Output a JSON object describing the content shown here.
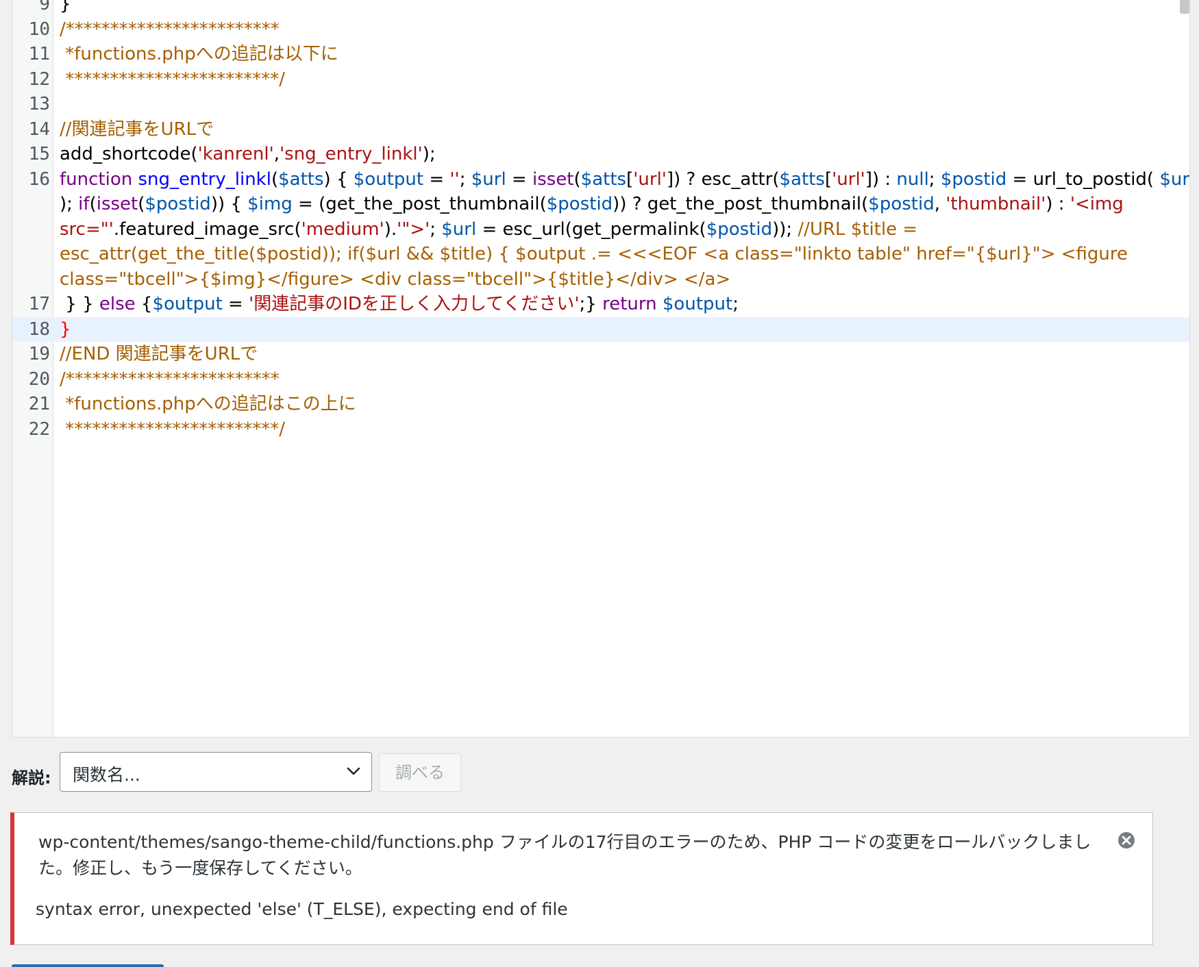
{
  "editor": {
    "lines": [
      {
        "num": "9",
        "segments": [
          {
            "t": "}",
            "c": "c-plain"
          }
        ]
      },
      {
        "num": "10",
        "segments": [
          {
            "t": "/************************",
            "c": "c-com"
          }
        ]
      },
      {
        "num": "11",
        "segments": [
          {
            "t": " *functions.phpへの追記は以下に",
            "c": "c-com"
          }
        ]
      },
      {
        "num": "12",
        "segments": [
          {
            "t": " ************************/",
            "c": "c-com"
          }
        ]
      },
      {
        "num": "13",
        "segments": []
      },
      {
        "num": "14",
        "segments": [
          {
            "t": "//関連記事をURLで",
            "c": "c-com"
          }
        ]
      },
      {
        "num": "15",
        "segments": [
          {
            "t": "add_shortcode(",
            "c": "c-plain"
          },
          {
            "t": "'kanrenl'",
            "c": "c-str"
          },
          {
            "t": ",",
            "c": "c-plain"
          },
          {
            "t": "'sng_entry_linkl'",
            "c": "c-str"
          },
          {
            "t": ");",
            "c": "c-plain"
          }
        ]
      },
      {
        "num": "16",
        "segments": [
          {
            "t": "function ",
            "c": "c-kw"
          },
          {
            "t": "sng_entry_linkl",
            "c": "c-def"
          },
          {
            "t": "(",
            "c": "c-plain"
          },
          {
            "t": "$atts",
            "c": "c-var"
          },
          {
            "t": ") { ",
            "c": "c-plain"
          },
          {
            "t": "$output",
            "c": "c-var"
          },
          {
            "t": " = ",
            "c": "c-plain"
          },
          {
            "t": "''",
            "c": "c-str"
          },
          {
            "t": "; ",
            "c": "c-plain"
          },
          {
            "t": "$url",
            "c": "c-var"
          },
          {
            "t": " = ",
            "c": "c-plain"
          },
          {
            "t": "isset",
            "c": "c-kw"
          },
          {
            "t": "(",
            "c": "c-plain"
          },
          {
            "t": "$atts",
            "c": "c-var"
          },
          {
            "t": "[",
            "c": "c-plain"
          },
          {
            "t": "'url'",
            "c": "c-str"
          },
          {
            "t": "]) ? esc_attr(",
            "c": "c-plain"
          },
          {
            "t": "$atts",
            "c": "c-var"
          },
          {
            "t": "[",
            "c": "c-plain"
          },
          {
            "t": "'url'",
            "c": "c-str"
          },
          {
            "t": "]) : ",
            "c": "c-plain"
          },
          {
            "t": "null",
            "c": "c-var"
          },
          {
            "t": "; ",
            "c": "c-plain"
          },
          {
            "t": "$postid",
            "c": "c-var"
          },
          {
            "t": " = url_to_postid( ",
            "c": "c-plain"
          },
          {
            "t": "$url",
            "c": "c-var"
          }
        ]
      },
      {
        "num": "",
        "segments": [
          {
            "t": "); ",
            "c": "c-plain"
          },
          {
            "t": "if",
            "c": "c-kw"
          },
          {
            "t": "(",
            "c": "c-plain"
          },
          {
            "t": "isset",
            "c": "c-kw"
          },
          {
            "t": "(",
            "c": "c-plain"
          },
          {
            "t": "$postid",
            "c": "c-var"
          },
          {
            "t": ")) { ",
            "c": "c-plain"
          },
          {
            "t": "$img",
            "c": "c-var"
          },
          {
            "t": " = (get_the_post_thumbnail(",
            "c": "c-plain"
          },
          {
            "t": "$postid",
            "c": "c-var"
          },
          {
            "t": ")) ? get_the_post_thumbnail(",
            "c": "c-plain"
          },
          {
            "t": "$postid",
            "c": "c-var"
          },
          {
            "t": ", ",
            "c": "c-plain"
          },
          {
            "t": "'thumbnail'",
            "c": "c-str"
          },
          {
            "t": ") : ",
            "c": "c-plain"
          },
          {
            "t": "'<img",
            "c": "c-str"
          }
        ]
      },
      {
        "num": "",
        "segments": [
          {
            "t": "src=\"'",
            "c": "c-str"
          },
          {
            "t": ".featured_image_src(",
            "c": "c-plain"
          },
          {
            "t": "'medium'",
            "c": "c-str"
          },
          {
            "t": ").",
            "c": "c-plain"
          },
          {
            "t": "'\">'",
            "c": "c-str"
          },
          {
            "t": "; ",
            "c": "c-plain"
          },
          {
            "t": "$url",
            "c": "c-var"
          },
          {
            "t": " = esc_url(get_permalink(",
            "c": "c-plain"
          },
          {
            "t": "$postid",
            "c": "c-var"
          },
          {
            "t": ")); ",
            "c": "c-plain"
          },
          {
            "t": "//URL $title =",
            "c": "c-com"
          }
        ]
      },
      {
        "num": "",
        "segments": [
          {
            "t": "esc_attr(get_the_title($postid)); if($url && $title) { $output .= <<<EOF <a class=\"linkto table\" href=\"{$url}\"> <figure",
            "c": "c-com"
          }
        ]
      },
      {
        "num": "",
        "segments": [
          {
            "t": "class=\"tbcell\">{$img}</figure> <div class=\"tbcell\">{$title}</div> </a>",
            "c": "c-com"
          }
        ]
      },
      {
        "num": "17",
        "segments": [
          {
            "t": " } } ",
            "c": "c-plain"
          },
          {
            "t": "else",
            "c": "c-kw"
          },
          {
            "t": " {",
            "c": "c-plain"
          },
          {
            "t": "$output",
            "c": "c-var"
          },
          {
            "t": " = ",
            "c": "c-plain"
          },
          {
            "t": "'関連記事のIDを正しく入力してください'",
            "c": "c-str"
          },
          {
            "t": ";} ",
            "c": "c-plain"
          },
          {
            "t": "return ",
            "c": "c-kw"
          },
          {
            "t": "$output",
            "c": "c-var"
          },
          {
            "t": ";",
            "c": "c-plain"
          }
        ]
      },
      {
        "num": "18",
        "active": true,
        "segments": [
          {
            "t": "}",
            "c": "c-bad"
          }
        ]
      },
      {
        "num": "19",
        "segments": [
          {
            "t": "//END 関連記事をURLで",
            "c": "c-com"
          }
        ]
      },
      {
        "num": "20",
        "segments": [
          {
            "t": "/************************",
            "c": "c-com"
          }
        ]
      },
      {
        "num": "21",
        "segments": [
          {
            "t": " *functions.phpへの追記はこの上に",
            "c": "c-com"
          }
        ]
      },
      {
        "num": "22",
        "segments": [
          {
            "t": " ************************/",
            "c": "c-com"
          }
        ]
      }
    ]
  },
  "help": {
    "label": "解説:",
    "select_value": "関数名...",
    "lookup_button": "調べる"
  },
  "notice": {
    "message": "wp-content/themes/sango-theme-child/functions.php ファイルの17行目のエラーのため、PHP コードの変更をロールバックしました。修正し、もう一度保存してください。",
    "detail": "syntax error, unexpected 'else' (T_ELSE), expecting end of file"
  },
  "colors": {
    "comment": "#a55f00",
    "string": "#aa1111",
    "variable": "#0055aa",
    "keyword": "#770088",
    "error_border": "#d63638"
  }
}
